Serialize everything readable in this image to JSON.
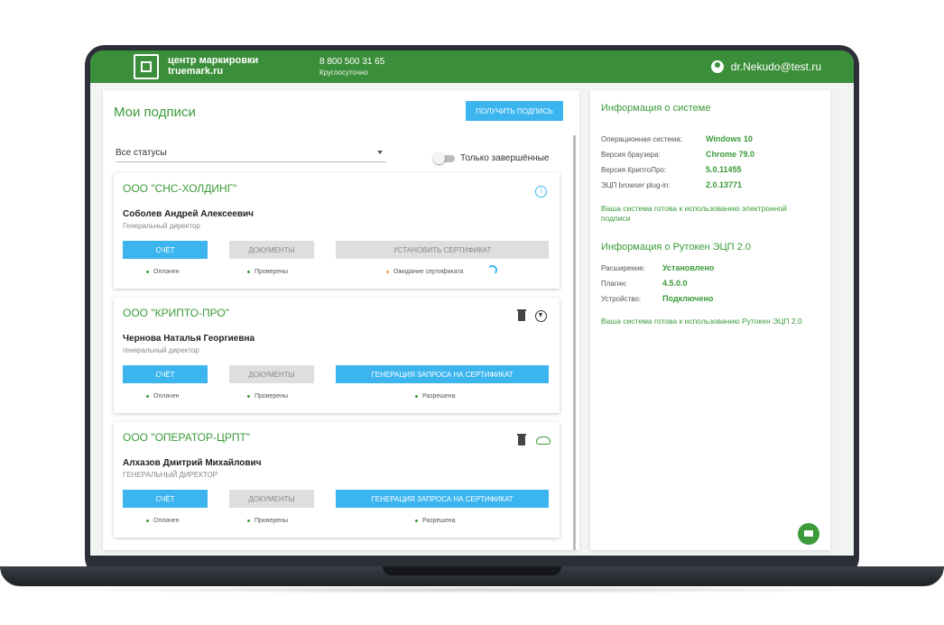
{
  "header": {
    "brand_line1": "центр маркировки",
    "brand_line2": "truemark.ru",
    "phone": "8 800 500 31 65",
    "phone_sub": "Круглосуточно",
    "user_email": "dr.Nekudo@test.ru"
  },
  "left": {
    "title": "Мои подписи",
    "get_button": "ПОЛУЧИТЬ ПОДПИСЬ",
    "status_select": "Все статусы",
    "toggle_label": "Только завершённые",
    "cards": [
      {
        "org": "ООО \"СНС-ХОЛДИНГ\"",
        "person": "Соболев Андрей Алексеевич",
        "role": "Генеральный директор",
        "btn1": "СЧЁТ",
        "btn2": "ДОКУМЕНТЫ",
        "btn3": "УСТАНОВИТЬ СЕРТИФИКАТ",
        "st1": "Оплачен",
        "st2": "Проверены",
        "st3": "Ожидание сертификата"
      },
      {
        "org": "ООО \"КРИПТО-ПРО\"",
        "person": "Чернова Наталья Георгиевна",
        "role": "генеральный директор",
        "btn1": "СЧЁТ",
        "btn2": "ДОКУМЕНТЫ",
        "btn3": "ГЕНЕРАЦИЯ ЗАПРОСА НА СЕРТИФИКАТ",
        "st1": "Оплачен",
        "st2": "Проверены",
        "st3": "Разрешена"
      },
      {
        "org": "ООО \"ОПЕРАТОР-ЦРПТ\"",
        "person": "Алхазов Дмитрий Михайлович",
        "role": "ГЕНЕРАЛЬНЫЙ ДИРЕКТОР",
        "btn1": "СЧЁТ",
        "btn2": "ДОКУМЕНТЫ",
        "btn3": "ГЕНЕРАЦИЯ ЗАПРОСА НА СЕРТИФИКАТ",
        "st1": "Оплачен",
        "st2": "Проверены",
        "st3": "Разрешена"
      }
    ]
  },
  "right": {
    "sys_title": "Информация о системе",
    "sys_os_label": "Операционная система:",
    "sys_os_value": "Windows 10",
    "sys_browser_label": "Версия браузера:",
    "sys_browser_value": "Chrome 79.0",
    "sys_cp_label": "Версия КриптоПро:",
    "sys_cp_value": "5.0.11455",
    "sys_plugin_label": "ЭЦП browser plug-in:",
    "sys_plugin_value": "2.0.13771",
    "sys_ready": "Ваша система готова к использованию электронной подписи",
    "ru_title": "Информация о Рутокен ЭЦП 2.0",
    "ru_ext_label": "Расширение:",
    "ru_ext_value": "Установлено",
    "ru_plugin_label": "Плагин:",
    "ru_plugin_value": "4.5.0.0",
    "ru_dev_label": "Устройство:",
    "ru_dev_value": "Подключено",
    "ru_ready": "Ваша система готова к использованию Рутокен ЭЦП 2.0"
  }
}
